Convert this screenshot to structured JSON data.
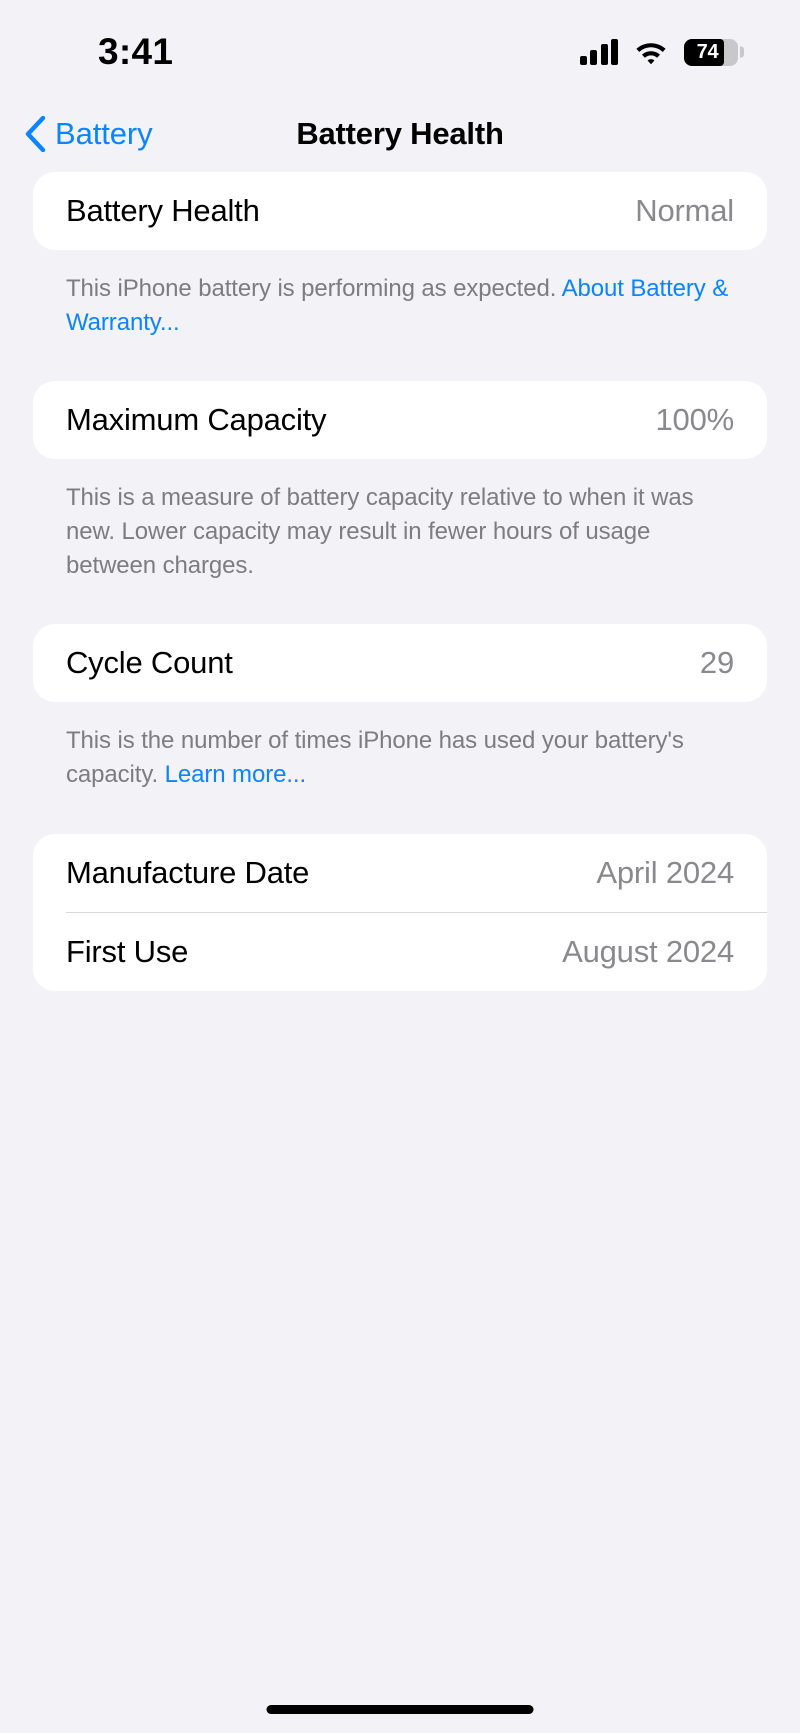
{
  "status_bar": {
    "time": "3:41",
    "signal_icon": "cellular-signal-icon",
    "wifi_icon": "wifi-icon",
    "battery_percent_label": "74",
    "battery_level": 74
  },
  "nav": {
    "back_label": "Battery",
    "back_icon": "chevron-left-icon",
    "title": "Battery Health"
  },
  "sections": {
    "battery_health": {
      "row_label": "Battery Health",
      "row_value": "Normal",
      "footer_text": "This iPhone battery is performing as expected. ",
      "footer_link": "About Battery & Warranty..."
    },
    "maximum_capacity": {
      "row_label": "Maximum Capacity",
      "row_value": "100%",
      "footer_text": "This is a measure of battery capacity relative to when it was new. Lower capacity may result in fewer hours of usage between charges."
    },
    "cycle_count": {
      "row_label": "Cycle Count",
      "row_value": "29",
      "footer_text": "This is the number of times iPhone has used your battery's capacity. ",
      "footer_link": "Learn more..."
    },
    "dates": {
      "manufacture_date_label": "Manufacture Date",
      "manufacture_date_value": "April 2024",
      "first_use_label": "First Use",
      "first_use_value": "August 2024"
    }
  },
  "colors": {
    "accent_blue": "#0a84ff",
    "page_background": "#f2f2f7",
    "card_background": "#ffffff",
    "secondary_text": "#8a8a8e"
  }
}
